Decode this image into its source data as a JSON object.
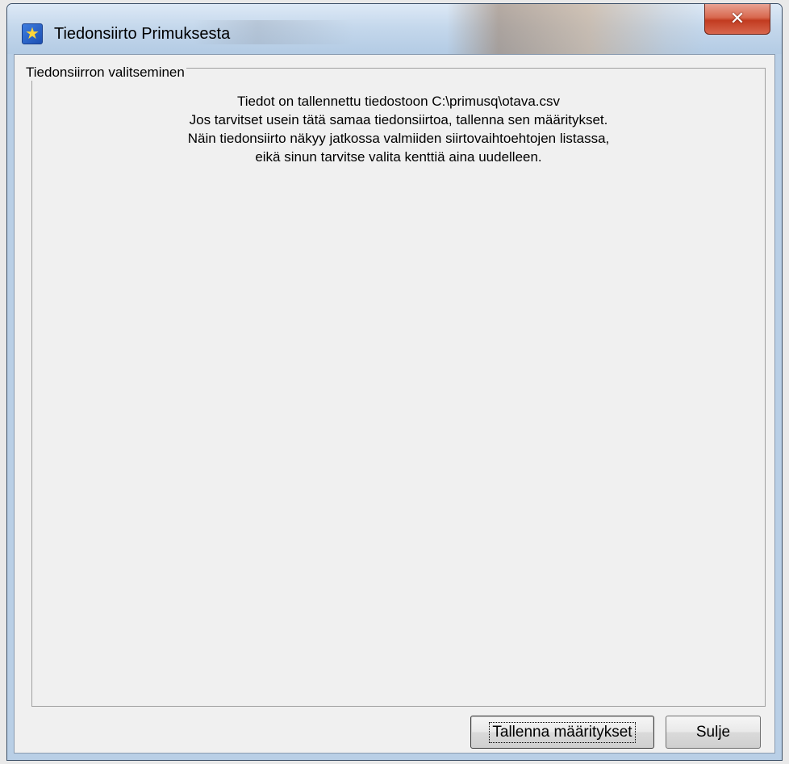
{
  "window": {
    "title": "Tiedonsiirto Primuksesta",
    "icon": "star-icon",
    "close_glyph": "✕"
  },
  "group": {
    "legend": "Tiedonsiirron valitseminen"
  },
  "message": {
    "lines": [
      "Tiedot on tallennettu tiedostoon C:\\primusq\\otava.csv",
      "Jos tarvitset usein tätä samaa tiedonsiirtoa, tallenna sen määritykset.",
      "Näin tiedonsiirto näkyy jatkossa valmiiden siirtovaihtoehtojen listassa,",
      "eikä sinun tarvitse valita kenttiä aina uudelleen."
    ]
  },
  "buttons": {
    "save_label": "Tallenna määritykset",
    "close_label": "Sulje"
  },
  "colors": {
    "titlebar": "#c5d8ec",
    "close_button": "#c23b20",
    "client_bg": "#f0f0f0"
  }
}
